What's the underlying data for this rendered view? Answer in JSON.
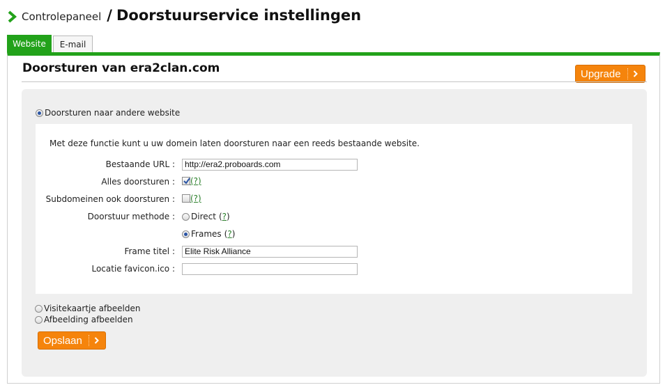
{
  "breadcrumb": {
    "parent": "Controlepaneel",
    "separator": "/",
    "title": "Doorstuurservice instellingen"
  },
  "tabs": [
    {
      "label": "Website",
      "active": true
    },
    {
      "label": "E-mail",
      "active": false
    }
  ],
  "panel": {
    "heading": "Doorsturen van era2clan.com",
    "upgrade_label": "Upgrade"
  },
  "options": {
    "forward_website": "Doorsturen naar andere website",
    "business_card": "Visitekaartje afbeelden",
    "show_image": "Afbeelding afbeelden"
  },
  "form": {
    "intro": "Met deze functie kunt u uw domein laten doorsturen naar een reeds bestaande website.",
    "existing_url_label": "Bestaande URL :",
    "existing_url_value": "http://era2.proboards.com",
    "forward_all_label": "Alles doorsturen :",
    "forward_all_checked": true,
    "subdomains_label": "Subdomeinen ook doorsturen :",
    "subdomains_checked": false,
    "method_label": "Doorstuur methode :",
    "method_direct": "Direct",
    "method_frames": "Frames",
    "method_selected": "Frames",
    "help_text": "(?)",
    "help_open": "(",
    "help_q": "?",
    "help_close": ")",
    "frame_title_label": "Frame titel :",
    "frame_title_value": "Elite Risk Alliance",
    "favicon_label": "Locatie favicon.ico :",
    "favicon_value": ""
  },
  "save_label": "Opslaan",
  "colors": {
    "accent_green": "#22a21a",
    "button_orange": "#f5840c",
    "help_green": "#2a7f2a"
  },
  "icons": {
    "breadcrumb": "chevron-right-icon",
    "button": "chevron-right-icon"
  }
}
